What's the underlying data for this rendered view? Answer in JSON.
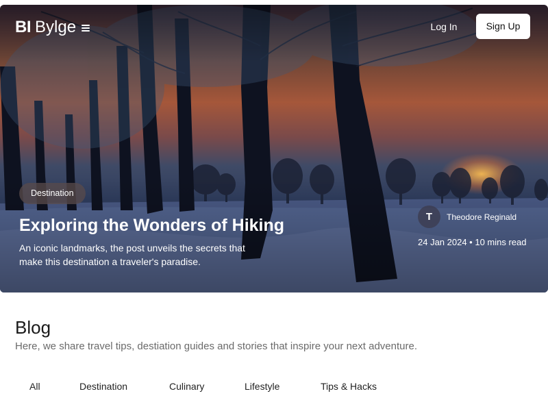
{
  "header": {
    "logo_mark": "BI",
    "logo_name": "Bylge",
    "login_label": "Log In",
    "signup_label": "Sign Up"
  },
  "hero": {
    "tag": "Destination",
    "title": "Exploring the Wonders of Hiking",
    "subtitle": "An iconic landmarks, the post unveils the secrets that make this destination a traveler's paradise.",
    "author_initial": "T",
    "author_name": "Theodore Reginald",
    "meta": "24 Jan 2024 • 10 mins read"
  },
  "blog": {
    "title": "Blog",
    "description": "Here, we share travel tips, destiation guides and stories that inspire your next adventure.",
    "tabs": [
      "All",
      "Destination",
      "Culinary",
      "Lifestyle",
      "Tips & Hacks"
    ]
  },
  "icons": [
    "menu-icon"
  ],
  "colors": {
    "button_bg": "#ffffff",
    "tag_bg": "#5a4b4b"
  }
}
